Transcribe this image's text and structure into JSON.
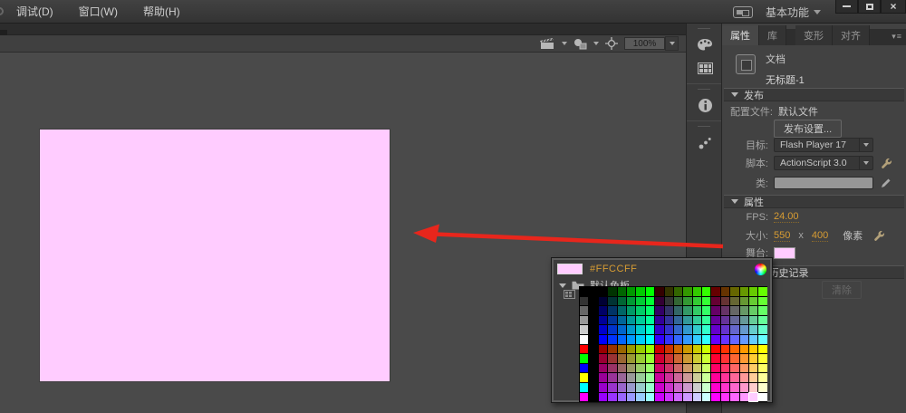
{
  "menu_bar": {
    "items": [
      {
        "label": "调试(D)"
      },
      {
        "label": "窗口(W)"
      },
      {
        "label": "帮助(H)"
      }
    ],
    "workspace_label": "基本功能"
  },
  "edit_bar": {
    "zoom_value": "100%"
  },
  "panel_tabs": {
    "properties": "属性",
    "library": "库",
    "transform": "变形",
    "align": "对齐"
  },
  "document": {
    "type_label": "文档",
    "name": "无标题-1"
  },
  "sections": {
    "publish": "发布",
    "properties": "属性",
    "swf_history": "SWF 历史记录"
  },
  "publish": {
    "profile_label": "配置文件:",
    "profile_value": "默认文件",
    "publish_settings_button": "发布设置...",
    "target_label": "目标:",
    "target_value": "Flash Player 17",
    "script_label": "脚本:",
    "script_value": "ActionScript 3.0",
    "class_label": "类:"
  },
  "properties": {
    "fps_label": "FPS:",
    "fps_value": "24.00",
    "size_label": "大小:",
    "size_width": "550",
    "size_times": "x",
    "size_height": "400",
    "size_unit": "像素",
    "stage_label": "舞台:",
    "stage_color": "#FFCCFF"
  },
  "swf_history": {
    "clear_button": "清除"
  },
  "color_picker": {
    "hex": "#FFCCFF",
    "palette_name": "默认色板",
    "selected": {
      "row": 11,
      "col": 16
    },
    "left_column": [
      "#000000",
      "#333333",
      "#666666",
      "#999999",
      "#CCCCCC",
      "#FFFFFF",
      "#FF0000",
      "#00FF00",
      "#0000FF",
      "#FFFF00",
      "#00FFFF",
      "#FF00FF"
    ],
    "grid": [
      [
        "#000000",
        "#003300",
        "#006600",
        "#009900",
        "#00CC00",
        "#00FF00",
        "#330000",
        "#333300",
        "#336600",
        "#339900",
        "#33CC00",
        "#33FF00",
        "#660000",
        "#663300",
        "#666600",
        "#669900",
        "#66CC00",
        "#66FF00"
      ],
      [
        "#000033",
        "#003333",
        "#006633",
        "#009933",
        "#00CC33",
        "#00FF33",
        "#330033",
        "#333333",
        "#336633",
        "#339933",
        "#33CC33",
        "#33FF33",
        "#660033",
        "#663333",
        "#666633",
        "#669933",
        "#66CC33",
        "#66FF33"
      ],
      [
        "#000066",
        "#003366",
        "#006666",
        "#009966",
        "#00CC66",
        "#00FF66",
        "#330066",
        "#333366",
        "#336666",
        "#339966",
        "#33CC66",
        "#33FF66",
        "#660066",
        "#663366",
        "#666666",
        "#669966",
        "#66CC66",
        "#66FF66"
      ],
      [
        "#000099",
        "#003399",
        "#006699",
        "#009999",
        "#00CC99",
        "#00FF99",
        "#330099",
        "#333399",
        "#336699",
        "#339999",
        "#33CC99",
        "#33FF99",
        "#660099",
        "#663399",
        "#666699",
        "#669999",
        "#66CC99",
        "#66FF99"
      ],
      [
        "#0000CC",
        "#0033CC",
        "#0066CC",
        "#0099CC",
        "#00CCCC",
        "#00FFCC",
        "#3300CC",
        "#3333CC",
        "#3366CC",
        "#3399CC",
        "#33CCCC",
        "#33FFCC",
        "#6600CC",
        "#6633CC",
        "#6666CC",
        "#6699CC",
        "#66CCCC",
        "#66FFCC"
      ],
      [
        "#0000FF",
        "#0033FF",
        "#0066FF",
        "#0099FF",
        "#00CCFF",
        "#00FFFF",
        "#3300FF",
        "#3333FF",
        "#3366FF",
        "#3399FF",
        "#33CCFF",
        "#33FFFF",
        "#6600FF",
        "#6633FF",
        "#6666FF",
        "#6699FF",
        "#66CCFF",
        "#66FFFF"
      ],
      [
        "#990000",
        "#993300",
        "#996600",
        "#999900",
        "#99CC00",
        "#99FF00",
        "#CC0000",
        "#CC3300",
        "#CC6600",
        "#CC9900",
        "#CCCC00",
        "#CCFF00",
        "#FF0000",
        "#FF3300",
        "#FF6600",
        "#FF9900",
        "#FFCC00",
        "#FFFF00"
      ],
      [
        "#990033",
        "#993333",
        "#996633",
        "#999933",
        "#99CC33",
        "#99FF33",
        "#CC0033",
        "#CC3333",
        "#CC6633",
        "#CC9933",
        "#CCCC33",
        "#CCFF33",
        "#FF0033",
        "#FF3333",
        "#FF6633",
        "#FF9933",
        "#FFCC33",
        "#FFFF33"
      ],
      [
        "#990066",
        "#993366",
        "#996666",
        "#999966",
        "#99CC66",
        "#99FF66",
        "#CC0066",
        "#CC3366",
        "#CC6666",
        "#CC9966",
        "#CCCC66",
        "#CCFF66",
        "#FF0066",
        "#FF3366",
        "#FF6666",
        "#FF9966",
        "#FFCC66",
        "#FFFF66"
      ],
      [
        "#990099",
        "#993399",
        "#996699",
        "#999999",
        "#99CC99",
        "#99FF99",
        "#CC0099",
        "#CC3399",
        "#CC6699",
        "#CC9999",
        "#CCCC99",
        "#CCFF99",
        "#FF0099",
        "#FF3399",
        "#FF6699",
        "#FF9999",
        "#FFCC99",
        "#FFFF99"
      ],
      [
        "#9900CC",
        "#9933CC",
        "#9966CC",
        "#9999CC",
        "#99CCCC",
        "#99FFCC",
        "#CC00CC",
        "#CC33CC",
        "#CC66CC",
        "#CC99CC",
        "#CCCCCC",
        "#CCFFCC",
        "#FF00CC",
        "#FF33CC",
        "#FF66CC",
        "#FF99CC",
        "#FFCCCC",
        "#FFFFCC"
      ],
      [
        "#9900FF",
        "#9933FF",
        "#9966FF",
        "#9999FF",
        "#99CCFF",
        "#99FFFF",
        "#CC00FF",
        "#CC33FF",
        "#CC66FF",
        "#CC99FF",
        "#CCCCFF",
        "#CCFFFF",
        "#FF00FF",
        "#FF33FF",
        "#FF66FF",
        "#FF99FF",
        "#FFCCFF",
        "#FFFFFF"
      ]
    ]
  },
  "stage": {
    "color": "#FFCCFF"
  },
  "colors": {
    "accent_orange": "#D79C33",
    "arrow_red": "#E8261C",
    "stage_pink": "#FFCCFF"
  }
}
